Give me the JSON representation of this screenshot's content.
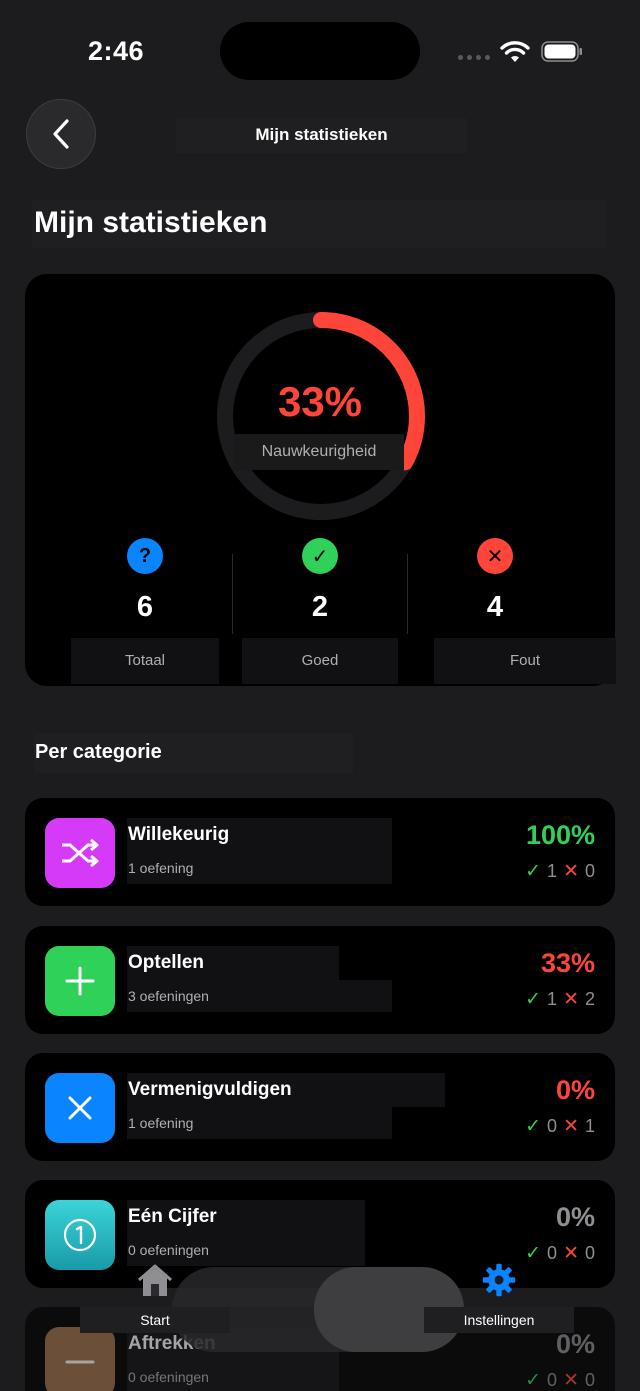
{
  "status": {
    "time": "2:46"
  },
  "nav": {
    "title": "Mijn statistieken"
  },
  "page": {
    "title": "Mijn statistieken"
  },
  "summary": {
    "accuracy_pct": "33%",
    "accuracy_value": 0.33,
    "accuracy_label": "Nauwkeurigheid",
    "stats": [
      {
        "icon": "question-icon",
        "value": "6",
        "label": "Totaal",
        "color": "#0a84ff",
        "glyph": "?"
      },
      {
        "icon": "check-icon",
        "value": "2",
        "label": "Goed",
        "color": "#30d158",
        "glyph": "✓"
      },
      {
        "icon": "cross-icon",
        "value": "4",
        "label": "Fout",
        "color": "#ff453a",
        "glyph": "✕"
      }
    ]
  },
  "section": {
    "title": "Per categorie"
  },
  "categories": [
    {
      "name": "Willekeurig",
      "sub": "1 oefening",
      "pct": "100%",
      "pct_color": "#30d158",
      "good": "1",
      "bad": "0",
      "icon": "shuffle-icon",
      "icon_bg": "#d63af9"
    },
    {
      "name": "Optellen",
      "sub": "3 oefeningen",
      "pct": "33%",
      "pct_color": "#ff453a",
      "good": "1",
      "bad": "2",
      "icon": "plus-icon",
      "icon_bg": "#30d158"
    },
    {
      "name": "Vermenigvuldigen",
      "sub": "1 oefening",
      "pct": "0%",
      "pct_color": "#ff453a",
      "good": "0",
      "bad": "1",
      "icon": "multiply-icon",
      "icon_bg": "#0a84ff"
    },
    {
      "name": "Eén Cijfer",
      "sub": "0 oefeningen",
      "pct": "0%",
      "pct_color": "#8e8e93",
      "good": "0",
      "bad": "0",
      "icon": "digit-one-icon",
      "icon_bg": "#2bb6c8"
    },
    {
      "name": "Aftrekken",
      "sub": "0 oefeningen",
      "pct": "0%",
      "pct_color": "#8e8e93",
      "good": "0",
      "bad": "0",
      "icon": "minus-icon",
      "icon_bg": "#a2714a"
    }
  ],
  "tabs": [
    {
      "label": "Start",
      "icon": "home-icon"
    },
    {
      "label": "Instellingen",
      "icon": "gear-icon",
      "color": "#0a84ff"
    }
  ]
}
